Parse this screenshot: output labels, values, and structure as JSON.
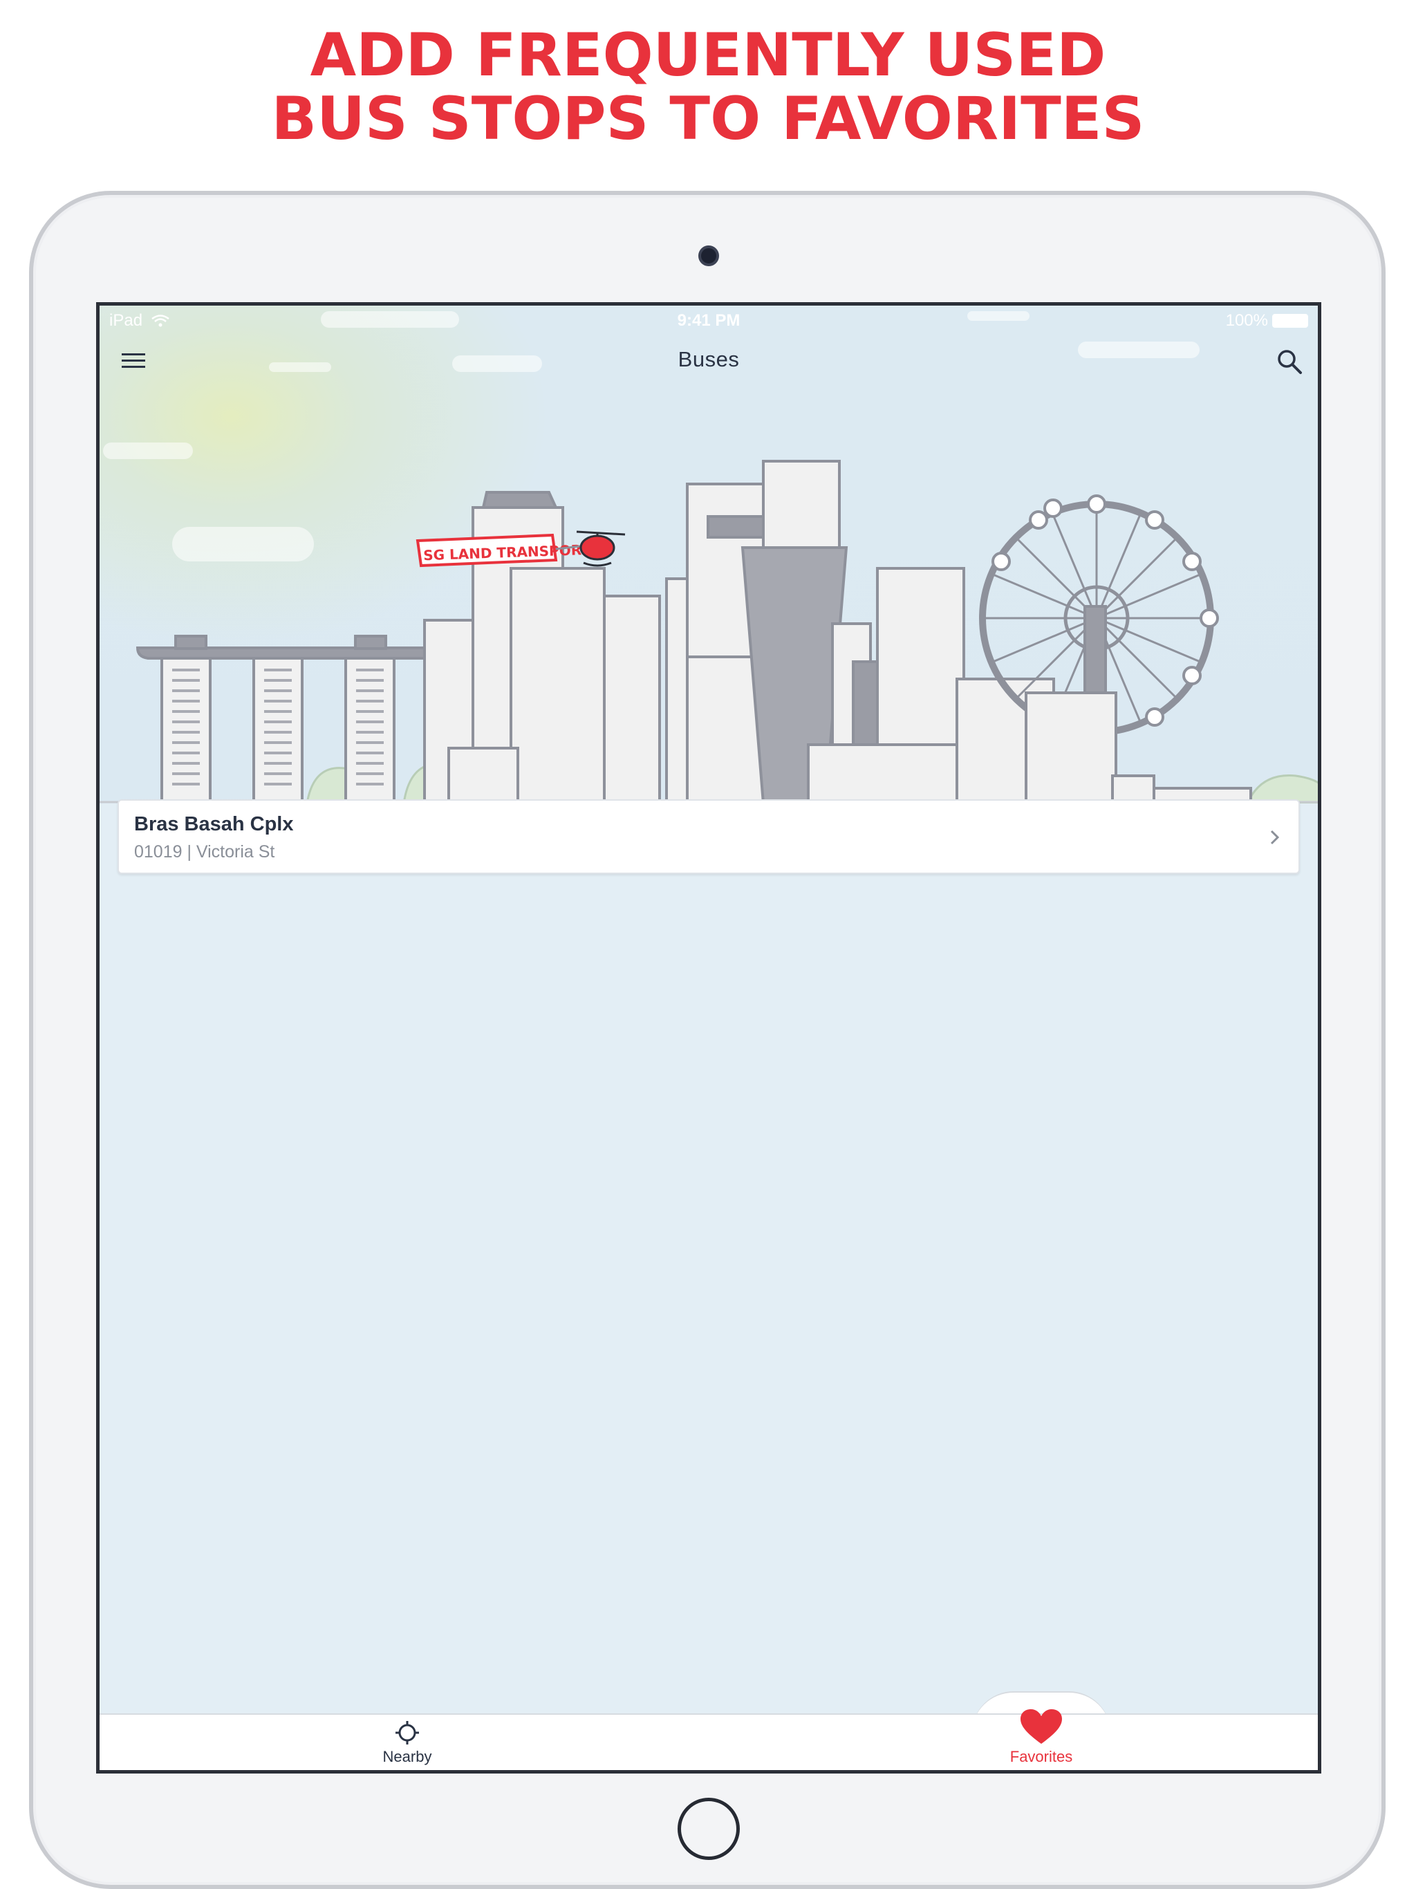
{
  "headline": {
    "line1": "ADD FREQUENTLY USED",
    "line2": "BUS STOPS TO FAVORITES"
  },
  "status_bar": {
    "device": "iPad",
    "time": "9:41 PM",
    "battery": "100%"
  },
  "nav": {
    "title": "Buses"
  },
  "banner": {
    "text": "SG LAND TRANSPORT"
  },
  "favorites": [
    {
      "name": "Bras Basah Cplx",
      "detail": "01019 | Victoria St"
    }
  ],
  "tabs": [
    {
      "label": "Nearby",
      "icon": "crosshair-icon",
      "active": false
    },
    {
      "label": "Favorites",
      "icon": "heart-icon",
      "active": true
    }
  ],
  "colors": {
    "accent": "#e8323c",
    "text": "#2a3344",
    "muted": "#8a8f98",
    "background": "#e3eef5"
  }
}
